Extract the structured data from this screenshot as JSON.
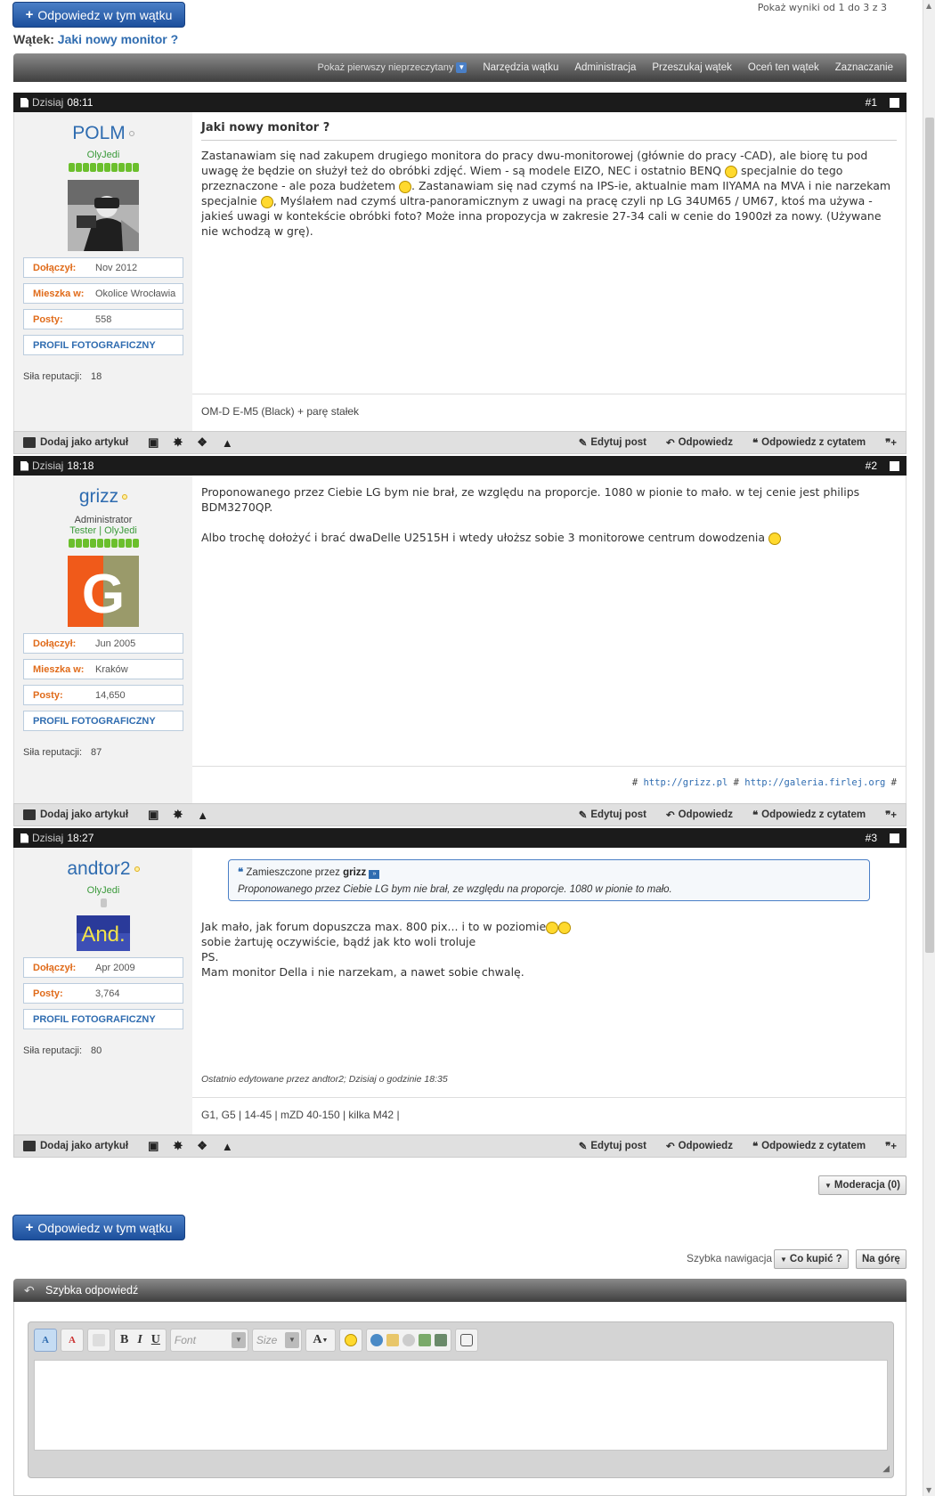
{
  "top": {
    "reply_button": "Odpowiedz w tym wątku",
    "pagination": "Pokaż wyniki od 1 do 3 z 3",
    "thread_label": "Wątek:",
    "thread_title": "Jaki nowy monitor ?"
  },
  "toolbar": {
    "items": [
      "Pokaż pierwszy nieprzeczytany",
      "Narzędzia wątku",
      "Administracja",
      "Przeszukaj wątek",
      "Oceń ten wątek",
      "Zaznaczanie"
    ]
  },
  "labels": {
    "today": "Dzisiaj",
    "joined": "Dołączył:",
    "lives": "Mieszka w:",
    "posts": "Posty:",
    "profile": "PROFIL FOTOGRAFICZNY",
    "reputation": "Siła reputacji:",
    "add_article": "Dodaj jako artykuł",
    "edit_post": "Edytuj post",
    "reply": "Odpowiedz",
    "reply_quote": "Odpowiedz z cytatem"
  },
  "posts": [
    {
      "time": "08:11",
      "number": "#1",
      "username": "POLM",
      "title_user": "OlyJedi",
      "joined": "Nov 2012",
      "location": "Okolice Wrocławia",
      "post_count": "558",
      "reputation": "18",
      "subject": "Jaki nowy monitor ?",
      "body_1": "Zastanawiam się nad zakupem drugiego monitora do pracy dwu-monitorowej (głównie do pracy -CAD), ale biorę tu pod uwagę że będzie on służył też do obróbki zdjęć. Wiem - są modele EIZO, NEC i ostatnio BENQ",
      "body_2": "specjalnie do tego przeznaczone - ale poza budżetem",
      "body_3": ". Zastanawiam się nad czymś na IPS-ie, aktualnie mam IIYAMA na MVA i nie narzekam specjalnie",
      "body_4": ", Myślałem nad czymś ultra-panoramicznym z uwagi na pracę czyli np LG 34UM65 / UM67, ktoś ma używa - jakieś uwagi w kontekście obróbki foto? Może inna propozycja w zakresie 27-34 cali w cenie do 1900zł za nowy. (Używane nie wchodzą w grę).",
      "signature": "OM-D E-M5 (Black) + parę stałek"
    },
    {
      "time": "18:18",
      "number": "#2",
      "username": "grizz",
      "title_admin": "Administrator",
      "title_user": "Tester | OlyJedi",
      "joined": "Jun 2005",
      "location": "Kraków",
      "post_count": "14,650",
      "reputation": "87",
      "body_1": "Proponowanego przez Ciebie LG bym nie brał, ze względu na proporcje. 1080 w pionie to mało. w tej cenie jest philips BDM3270QP.",
      "body_2": "Albo trochę dołożyć i brać dwaDelle U2515H i wtedy ułoższ sobie 3 monitorowe centrum dowodzenia",
      "sig_hash": "#",
      "sig_link1": "http://grizz.pl",
      "sig_link2": "http://galeria.firlej.org"
    },
    {
      "time": "18:27",
      "number": "#3",
      "username": "andtor2",
      "title_user": "OlyJedi",
      "joined": "Apr 2009",
      "post_count": "3,764",
      "reputation": "80",
      "quote_label": "Zamieszczone przez",
      "quote_author": "grizz",
      "quote_text": "Proponowanego przez Ciebie LG bym nie brał, ze względu na proporcje. 1080 w pionie to mało.",
      "body_1": "Jak mało, jak forum dopuszcza max. 800 pix... i to w poziomie",
      "body_2": "sobie żartuję oczywiście, bądź jak kto woli troluje",
      "body_3": "PS.",
      "body_4": "Mam monitor Della i nie narzekam, a nawet sobie chwalę.",
      "edited": "Ostatnio edytowane przez andtor2; Dzisiaj o godzinie 18:35",
      "signature": "G1, G5 | 14-45 | mZD 40-150 | kilka M42 |"
    }
  ],
  "bottom": {
    "moderation": "Moderacja (0)",
    "reply_button": "Odpowiedz w tym wątku",
    "quick_nav": "Szybka nawigacja",
    "forum_jump": "Co kupić ?",
    "top": "Na górę",
    "quick_reply": "Szybka odpowiedź",
    "font_placeholder": "Font",
    "size_placeholder": "Size"
  },
  "colors": {
    "accent": "#2f6cb0",
    "reply_button": "#1c4f9c",
    "label_orange": "#e06b1a",
    "rep_green": "#6bbf2c"
  },
  "reputation_bars": {
    "polm": {
      "filled": 10,
      "total": 10
    },
    "grizz": {
      "filled": 10,
      "total": 10
    },
    "andtor2": {
      "filled": 0,
      "total": 1
    }
  }
}
